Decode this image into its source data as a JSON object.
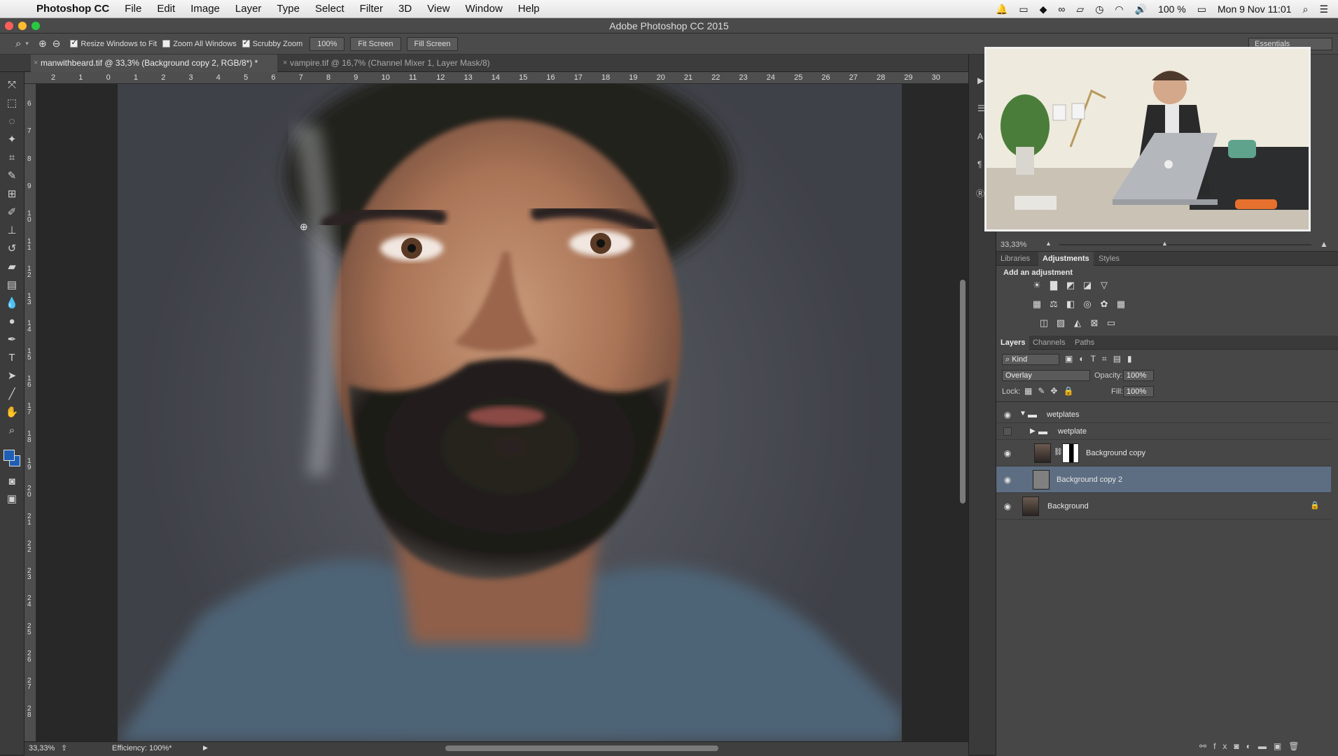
{
  "menubar": {
    "app_name": "Photoshop CC",
    "items": [
      "File",
      "Edit",
      "Image",
      "Layer",
      "Type",
      "Select",
      "Filter",
      "3D",
      "View",
      "Window",
      "Help"
    ],
    "battery": "100 %",
    "clock": "Mon 9 Nov  11:01"
  },
  "window": {
    "title": "Adobe Photoshop CC 2015"
  },
  "options": {
    "resize_windows": "Resize Windows to Fit",
    "zoom_all": "Zoom All Windows",
    "scrubby": "Scrubby Zoom",
    "zoom_value": "100%",
    "fit_screen": "Fit Screen",
    "fill_screen": "Fill Screen",
    "workspace": "Essentials"
  },
  "tabs": [
    {
      "label": "manwithbeard.tif @ 33,3% (Background copy 2, RGB/8*) *"
    },
    {
      "label": "vampire.tif @ 16,7% (Channel Mixer 1, Layer Mask/8)"
    }
  ],
  "ruler": {
    "h": [
      "2",
      "1",
      "0",
      "1",
      "2",
      "3",
      "4",
      "5",
      "6",
      "7",
      "8",
      "9",
      "10",
      "11",
      "12",
      "13",
      "14",
      "15",
      "16",
      "17",
      "18",
      "19",
      "20",
      "21",
      "22",
      "23",
      "24",
      "25",
      "26",
      "27",
      "28",
      "29",
      "30"
    ],
    "v": [
      "6",
      "7",
      "8",
      "9",
      "10",
      "11",
      "12",
      "13",
      "14",
      "15",
      "16",
      "17",
      "18",
      "19",
      "20",
      "21",
      "22",
      "23",
      "24",
      "25",
      "26",
      "27",
      "28"
    ]
  },
  "status": {
    "zoom": "33,33%",
    "efficiency": "Efficiency: 100%*"
  },
  "navigator": {
    "zoom": "33,33%"
  },
  "adjust_panel": {
    "tabs": [
      "Libraries",
      "Adjustments",
      "Styles"
    ],
    "heading": "Add an adjustment",
    "icons": [
      "brightness-icon",
      "levels-icon",
      "curves-icon",
      "exposure-icon",
      "vibrance-icon",
      "hue-saturation-icon",
      "color-balance-icon",
      "black-white-icon",
      "photo-filter-icon",
      "channel-mixer-icon",
      "color-lookup-icon",
      "invert-icon",
      "posterize-icon",
      "threshold-icon",
      "gradient-map-icon",
      "selective-color-icon"
    ]
  },
  "layers_panel": {
    "tabs": [
      "Layers",
      "Channels",
      "Paths"
    ],
    "filter_kind": "Kind",
    "blend_mode": "Overlay",
    "opacity_label": "Opacity:",
    "opacity_value": "100%",
    "lock_label": "Lock:",
    "fill_label": "Fill:",
    "fill_value": "100%",
    "layers": [
      {
        "name": "wetplates",
        "type": "group"
      },
      {
        "name": "wetplate",
        "type": "group"
      },
      {
        "name": "Background copy",
        "type": "layer"
      },
      {
        "name": "Background copy 2",
        "type": "layer"
      },
      {
        "name": "Background",
        "type": "layer"
      }
    ]
  },
  "colors": {
    "selected_layer": "#5d6d82",
    "foreground": "#1f5fb3",
    "background": "#1f5fb3"
  }
}
